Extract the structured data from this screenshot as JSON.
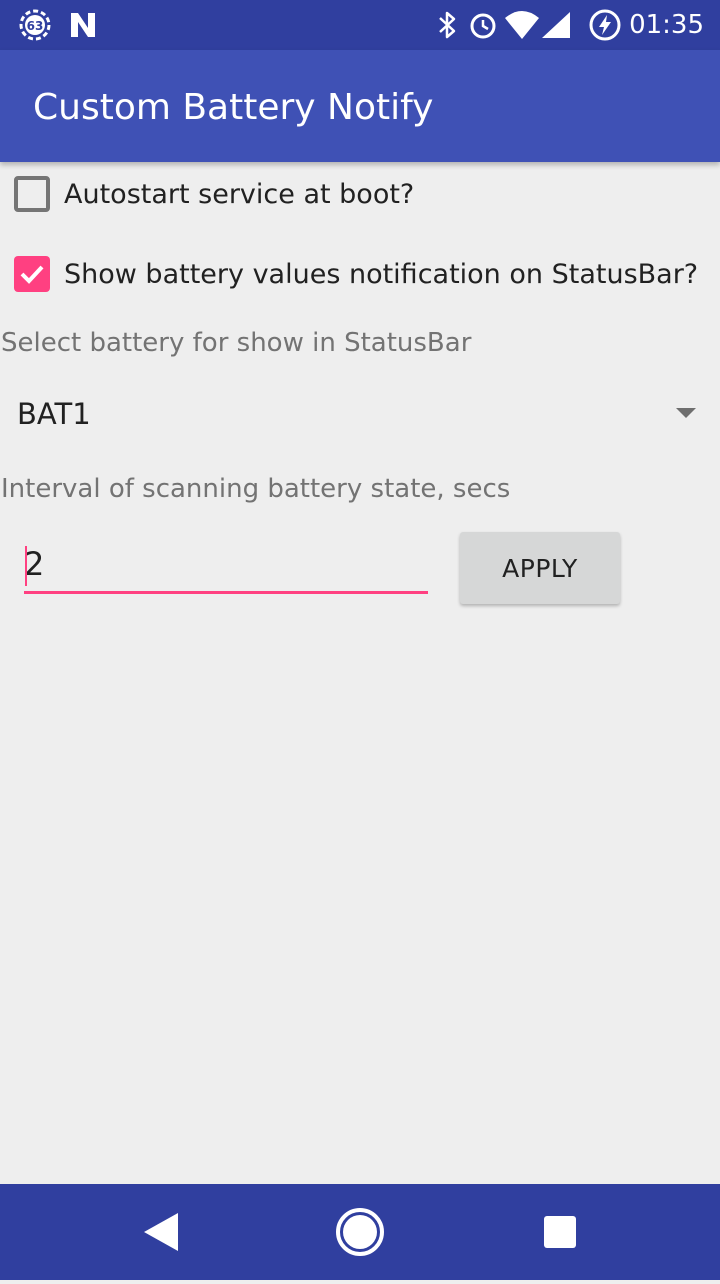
{
  "status_bar": {
    "notification_badge": "63",
    "time": "01:35",
    "icons": [
      "notification-63-icon",
      "n-app-icon",
      "bluetooth-icon",
      "alarm-icon",
      "wifi-icon",
      "cell-signal-icon",
      "battery-charging-icon"
    ]
  },
  "app_bar": {
    "title": "Custom Battery Notify"
  },
  "settings": {
    "autostart": {
      "label": "Autostart service at boot?",
      "checked": false
    },
    "show_notification": {
      "label": "Show battery values notification on StatusBar?",
      "checked": true
    },
    "battery_select": {
      "label": "Select battery for show in StatusBar",
      "selected": "BAT1"
    },
    "interval": {
      "label": "Interval of scanning battery state, secs",
      "value": "2",
      "apply_label": "APPLY"
    }
  },
  "nav_bar": {
    "icons": [
      "back-icon",
      "home-icon",
      "recents-icon"
    ]
  },
  "colors": {
    "status_bar": "#303f9f",
    "app_bar": "#3f51b5",
    "accent": "#ff4081",
    "background": "#eeeeee"
  }
}
